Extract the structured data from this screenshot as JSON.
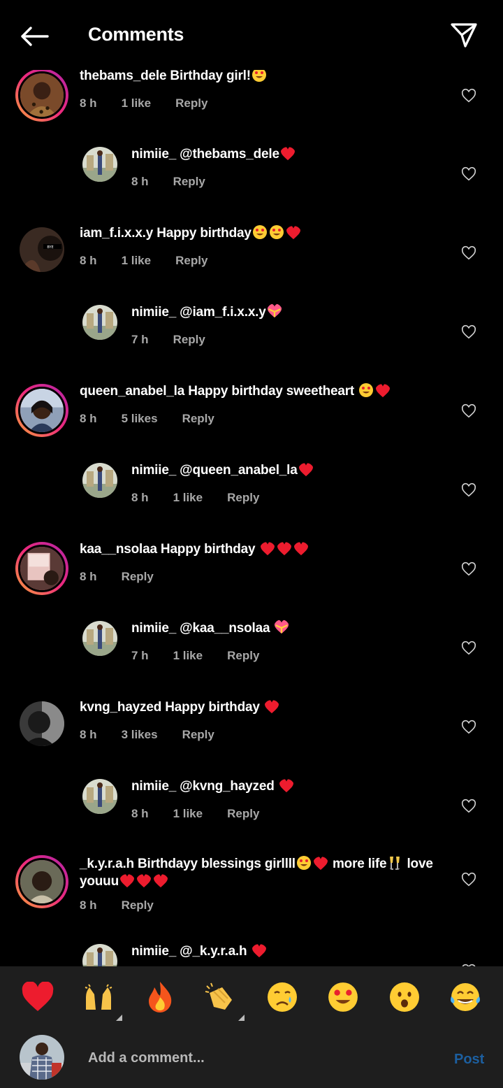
{
  "header": {
    "title": "Comments"
  },
  "comments": [
    {
      "user": "thebams_dele",
      "text": "Birthday girl!",
      "time": "8 h",
      "likes": "1 like",
      "reply": "Reply"
    },
    {
      "user": "nimiie_",
      "mention": "@thebams_dele",
      "time": "8 h",
      "likes": "",
      "reply": "Reply"
    },
    {
      "user": "iam_f.i.x.x.y",
      "text": "Happy birthday",
      "time": "8 h",
      "likes": "1 like",
      "reply": "Reply"
    },
    {
      "user": "nimiie_",
      "mention": "@iam_f.i.x.x.y",
      "time": "7 h",
      "likes": "",
      "reply": "Reply"
    },
    {
      "user": "queen_anabel_la",
      "text": "Happy birthday sweetheart",
      "time": "8 h",
      "likes": "5 likes",
      "reply": "Reply"
    },
    {
      "user": "nimiie_",
      "mention": "@queen_anabel_la",
      "time": "8 h",
      "likes": "1 like",
      "reply": "Reply"
    },
    {
      "user": "kaa__nsolaa",
      "text": "Happy birthday",
      "time": "8 h",
      "likes": "",
      "reply": "Reply"
    },
    {
      "user": "nimiie_",
      "mention": "@kaa__nsolaa",
      "time": "7 h",
      "likes": "1 like",
      "reply": "Reply"
    },
    {
      "user": "kvng_hayzed",
      "text": "Happy birthday",
      "time": "8 h",
      "likes": "3 likes",
      "reply": "Reply"
    },
    {
      "user": "nimiie_",
      "mention": "@kvng_hayzed",
      "time": "8 h",
      "likes": "1 like",
      "reply": "Reply"
    },
    {
      "user": "_k.y.r.a.h",
      "text": "Birthdayy blessings girllll",
      "text2": "more life",
      "text3": "love",
      "text4": "youuu",
      "time": "8 h",
      "likes": "",
      "reply": "Reply"
    },
    {
      "user": "nimiie_",
      "mention": "@_k.y.r.a.h"
    }
  ],
  "reactions": [
    "red-heart",
    "raising-hands",
    "fire",
    "clapping-hands",
    "crying-face",
    "heart-eyes-face",
    "surprised-face",
    "tears-of-joy-face"
  ],
  "input": {
    "placeholder": "Add a comment...",
    "post_label": "Post"
  },
  "colors": {
    "background": "#000000",
    "bar": "#1e1e1e",
    "meta_text": "#a8a8a8",
    "post_link": "#1c5fa0",
    "heart": "#ed1c2e"
  }
}
